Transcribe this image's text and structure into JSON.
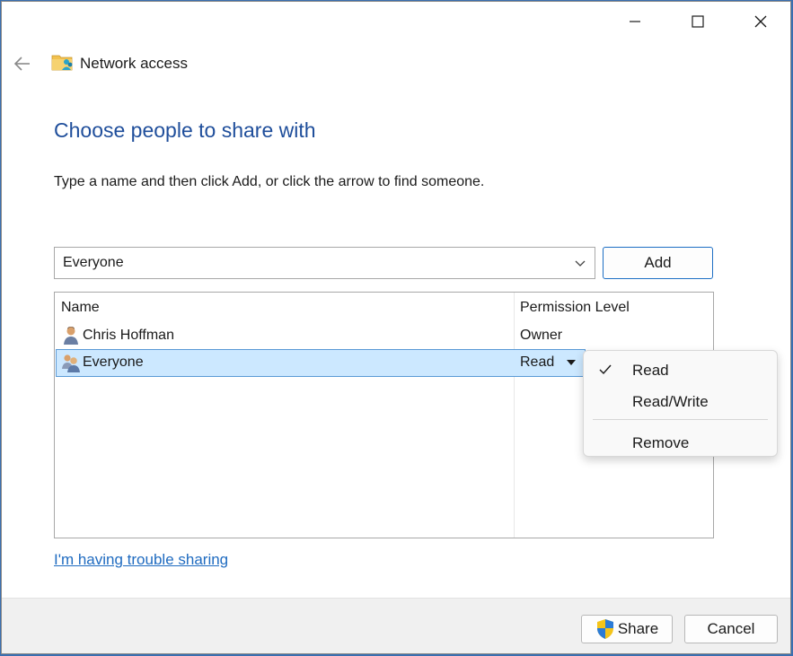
{
  "window": {
    "title": "Network access",
    "controls": [
      "minimize-icon",
      "maximize-icon",
      "close-icon"
    ],
    "accent": "#1f4e9b",
    "link_color": "#1f6bc0"
  },
  "content": {
    "heading": "Choose people to share with",
    "instruction": "Type a name and then click Add, or click the arrow to find someone.",
    "name_combo": {
      "value": "Everyone"
    },
    "add_label": "Add"
  },
  "list": {
    "columns": [
      "Name",
      "Permission Level"
    ],
    "rows": [
      {
        "name": "Chris Hoffman",
        "permission": "Owner",
        "icon": "user-icon",
        "selected": false
      },
      {
        "name": "Everyone",
        "permission": "Read",
        "icon": "group-icon",
        "selected": true
      }
    ]
  },
  "menu": {
    "items": [
      {
        "label": "Read",
        "checked": true
      },
      {
        "label": "Read/Write",
        "checked": false
      },
      {
        "label": "Remove",
        "checked": false
      }
    ]
  },
  "trouble_link": "I'm having trouble sharing",
  "footer": {
    "share_label": "Share",
    "cancel_label": "Cancel"
  }
}
